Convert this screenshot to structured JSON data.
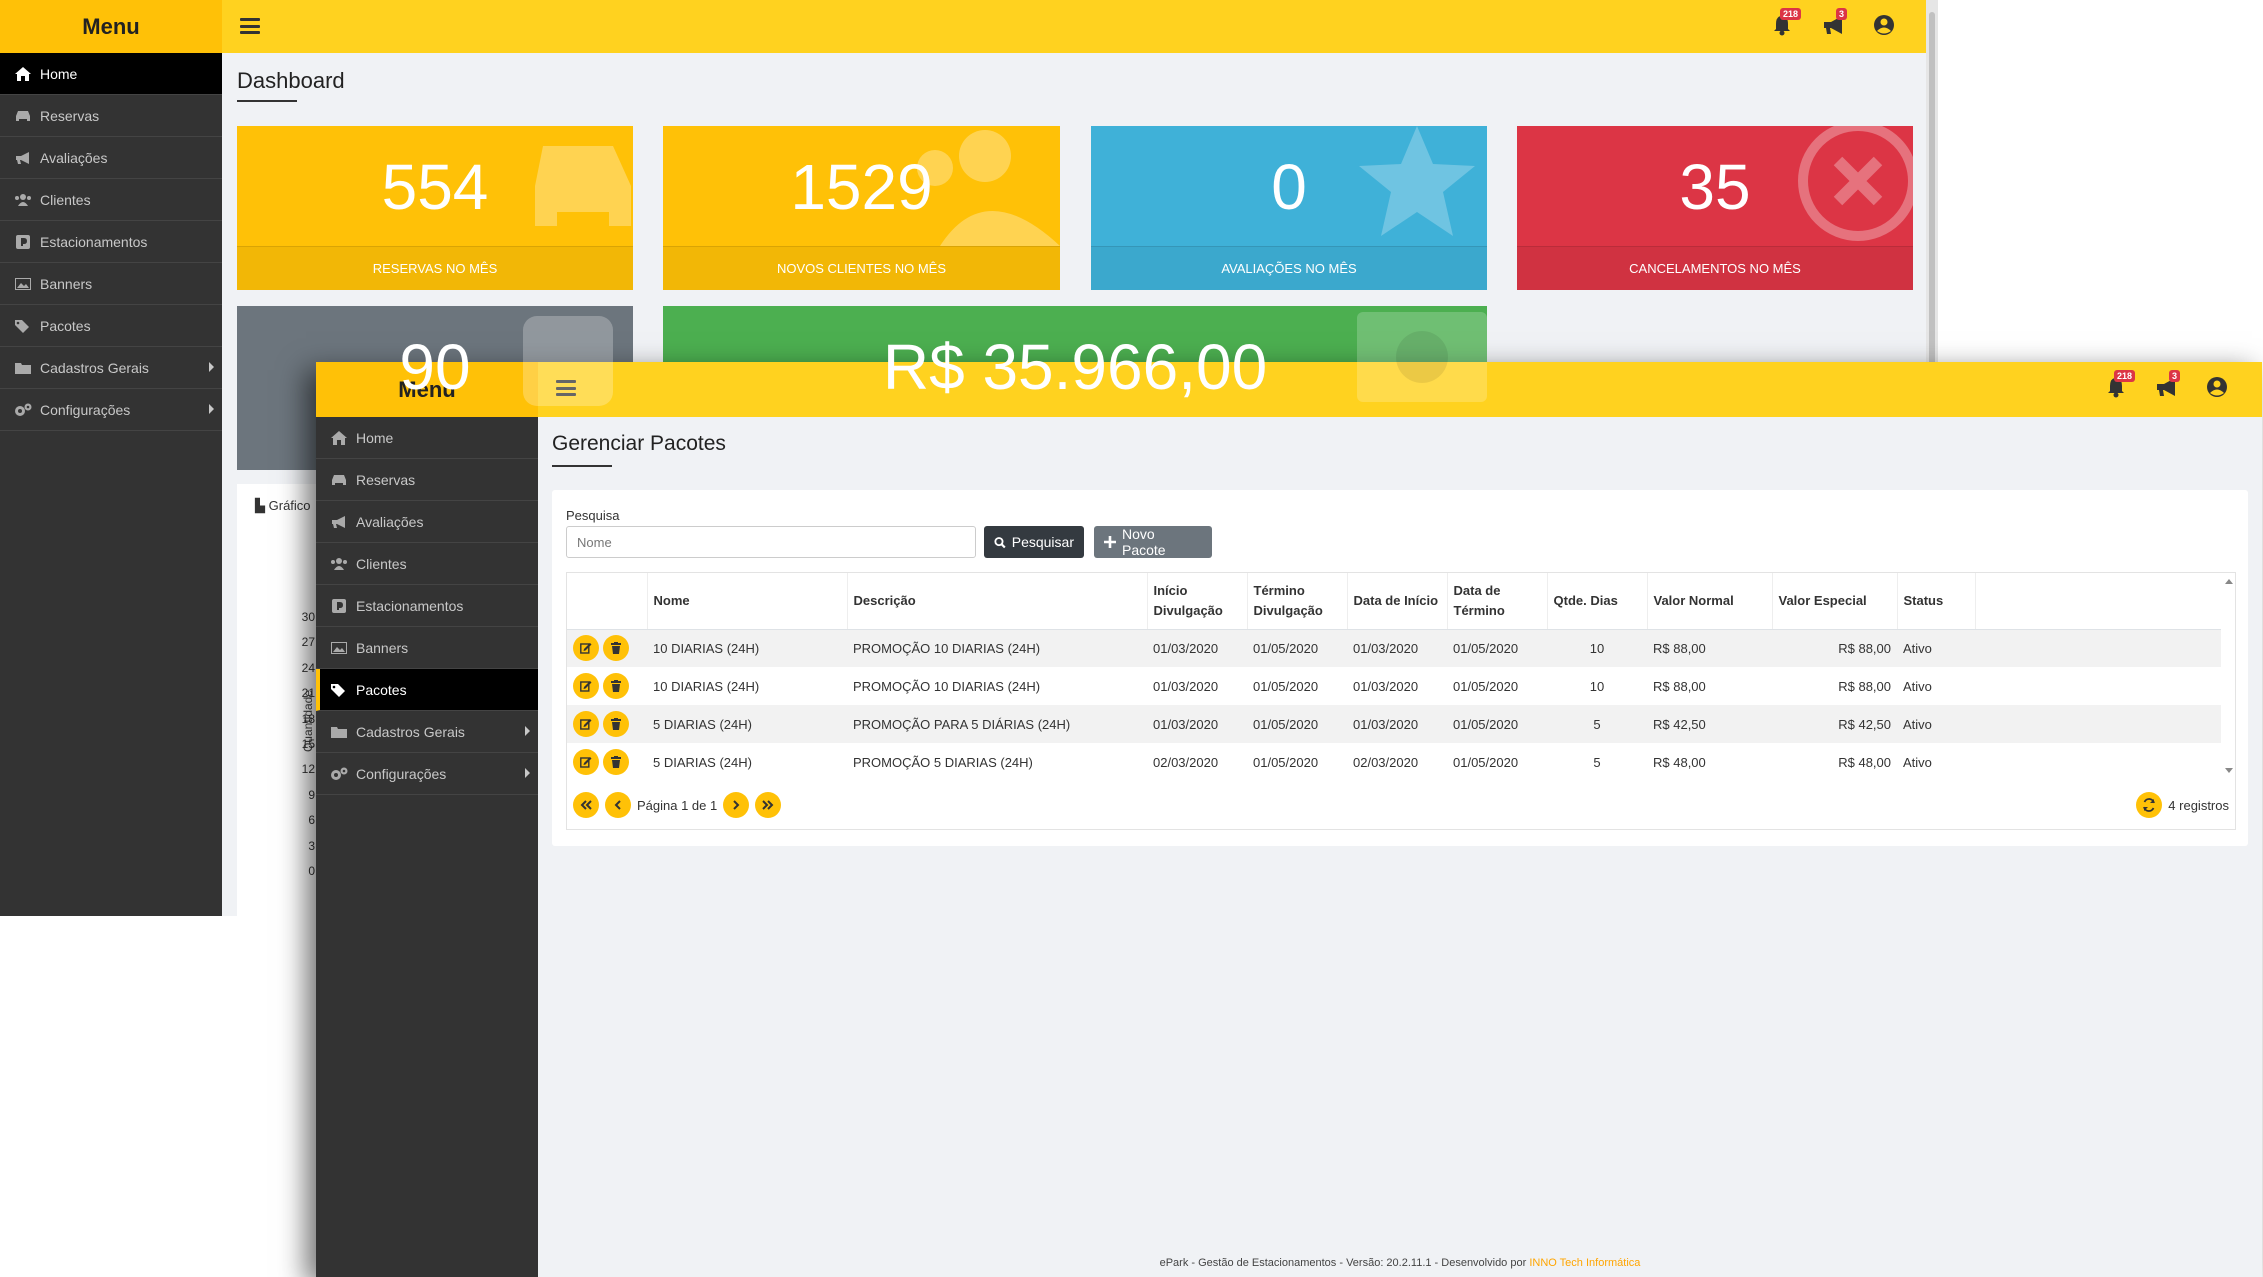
{
  "background_window": {
    "menu_title": "Menu",
    "sidebar": [
      {
        "label": "Home",
        "icon": "home-icon"
      },
      {
        "label": "Reservas",
        "icon": "car-icon"
      },
      {
        "label": "Avaliações",
        "icon": "megaphone-icon"
      },
      {
        "label": "Clientes",
        "icon": "users-icon"
      },
      {
        "label": "Estacionamentos",
        "icon": "parking-icon"
      },
      {
        "label": "Banners",
        "icon": "image-icon"
      },
      {
        "label": "Pacotes",
        "icon": "tags-icon"
      },
      {
        "label": "Cadastros Gerais",
        "icon": "folder-icon"
      },
      {
        "label": "Configurações",
        "icon": "gears-icon"
      }
    ],
    "badges": {
      "bell": "218",
      "megaphone": "3"
    },
    "page_title": "Dashboard",
    "stats": [
      {
        "value": "554",
        "label": "RESERVAS NO MÊS",
        "color": "#ffc107",
        "icon": "car-icon"
      },
      {
        "value": "1529",
        "label": "NOVOS CLIENTES NO MÊS",
        "color": "#ffc107",
        "icon": "users-icon"
      },
      {
        "value": "0",
        "label": "AVALIAÇÕES NO MÊS",
        "color": "#3fb1d8",
        "icon": "star-icon"
      },
      {
        "value": "35",
        "label": "CANCELAMENTOS NO MÊS",
        "color": "#dc3545",
        "icon": "times-circle-icon"
      }
    ],
    "stats_row2": [
      {
        "value": "90",
        "color": "#6c757d",
        "icon": "share-icon"
      },
      {
        "value": "R$ 35.966,00",
        "color": "#4caf50",
        "icon": "money-icon"
      }
    ],
    "chart_tab_label": "Gráfico",
    "chart_yaxis_label": "Quantidade",
    "chart_yticks": [
      "30",
      "27",
      "24",
      "21",
      "18",
      "15",
      "12",
      "9",
      "6",
      "3",
      "0"
    ]
  },
  "foreground_window": {
    "menu_title": "Menu",
    "sidebar": [
      {
        "label": "Home",
        "icon": "home-icon"
      },
      {
        "label": "Reservas",
        "icon": "car-icon"
      },
      {
        "label": "Avaliações",
        "icon": "megaphone-icon"
      },
      {
        "label": "Clientes",
        "icon": "users-icon"
      },
      {
        "label": "Estacionamentos",
        "icon": "parking-icon"
      },
      {
        "label": "Banners",
        "icon": "image-icon"
      },
      {
        "label": "Pacotes",
        "icon": "tags-icon",
        "active": true
      },
      {
        "label": "Cadastros Gerais",
        "icon": "folder-icon"
      },
      {
        "label": "Configurações",
        "icon": "gears-icon"
      }
    ],
    "badges": {
      "bell": "218",
      "megaphone": "3"
    },
    "page_title": "Gerenciar Pacotes",
    "search": {
      "label": "Pesquisa",
      "placeholder": "Nome",
      "value": ""
    },
    "buttons": {
      "search": "Pesquisar",
      "new": "Novo Pacote"
    },
    "table": {
      "columns": [
        "",
        "Nome",
        "Descrição",
        "Início Divulgação",
        "Término Divulgação",
        "Data de Início",
        "Data de Término",
        "Qtde. Dias",
        "Valor Normal",
        "Valor Especial",
        "Status"
      ],
      "rows": [
        {
          "nome": "10 DIARIAS (24H)",
          "descricao": "PROMOÇÃO 10 DIARIAS (24H)",
          "inicio_div": "01/03/2020",
          "termino_div": "01/05/2020",
          "data_inicio": "01/03/2020",
          "data_termino": "01/05/2020",
          "dias": "10",
          "valor_normal": "R$ 88,00",
          "valor_especial": "R$ 88,00",
          "status": "Ativo"
        },
        {
          "nome": "10 DIARIAS (24H)",
          "descricao": "PROMOÇÃO 10 DIARIAS (24H)",
          "inicio_div": "01/03/2020",
          "termino_div": "01/05/2020",
          "data_inicio": "01/03/2020",
          "data_termino": "01/05/2020",
          "dias": "10",
          "valor_normal": "R$ 88,00",
          "valor_especial": "R$ 88,00",
          "status": "Ativo"
        },
        {
          "nome": "5 DIARIAS (24H)",
          "descricao": "PROMOÇÃO PARA 5 DIÁRIAS (24H)",
          "inicio_div": "01/03/2020",
          "termino_div": "01/05/2020",
          "data_inicio": "01/03/2020",
          "data_termino": "01/05/2020",
          "dias": "5",
          "valor_normal": "R$ 42,50",
          "valor_especial": "R$ 42,50",
          "status": "Ativo"
        },
        {
          "nome": "5 DIARIAS (24H)",
          "descricao": "PROMOÇÃO 5 DIARIAS (24H)",
          "inicio_div": "02/03/2020",
          "termino_div": "01/05/2020",
          "data_inicio": "02/03/2020",
          "data_termino": "01/05/2020",
          "dias": "5",
          "valor_normal": "R$ 48,00",
          "valor_especial": "R$ 48,00",
          "status": "Ativo"
        }
      ]
    },
    "pager": {
      "text": "Página 1 de 1",
      "records": "4 registros"
    },
    "footer": {
      "text": "ePark - Gestão de Estacionamentos - Versão: 20.2.11.1 - Desenvolvido por ",
      "link": "INNO Tech Informática"
    }
  }
}
